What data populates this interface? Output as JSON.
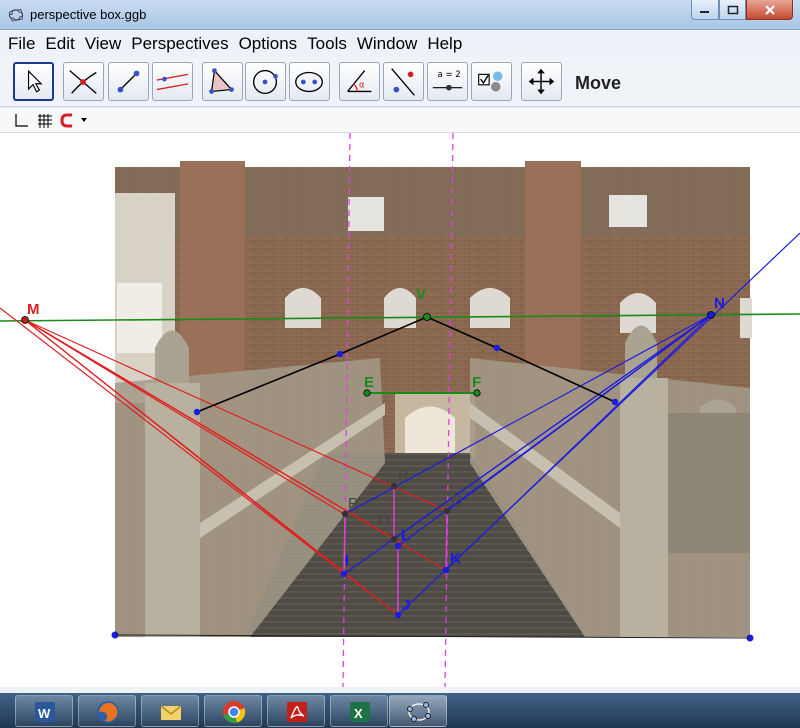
{
  "window": {
    "title": "perspective box.ggb"
  },
  "menu": [
    "File",
    "Edit",
    "View",
    "Perspectives",
    "Options",
    "Tools",
    "Window",
    "Help"
  ],
  "toolbar": {
    "selected_tool_label": "Move",
    "tools": [
      "move-tool",
      "point-tool",
      "line-tool",
      "perpendicular-tool",
      "polygon-tool",
      "circle-tool",
      "conic-tool",
      "angle-tool",
      "reflect-tool",
      "slider-tool",
      "checkbox-tool",
      "move-view-tool"
    ],
    "slider_tool_text": "a = 2"
  },
  "points": {
    "M": "M",
    "N": "N",
    "V": "V",
    "E": "E",
    "F": "F",
    "P": "P",
    "Q": "Q",
    "R": "R",
    "O": "O",
    "I": "I",
    "J": "J",
    "K": "K",
    "L": "L"
  },
  "colors": {
    "horizon": "#1a8a1a",
    "left_vanishing": "#e02020",
    "right_vanishing": "#1c1ce0",
    "black_lines": "#000000",
    "guides": "#e040e0",
    "point_dark": "#333333"
  },
  "taskbar": [
    "word-app",
    "firefox-app",
    "outlook-app",
    "chrome-app",
    "acrobat-app",
    "excel-app",
    "geogebra-app"
  ]
}
